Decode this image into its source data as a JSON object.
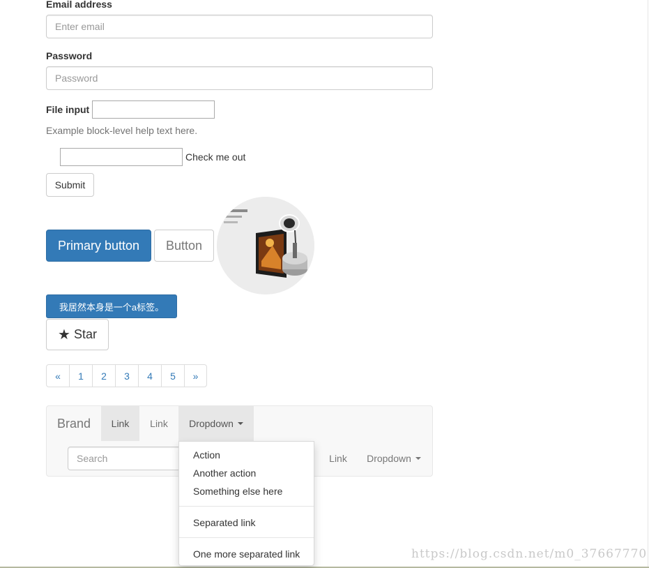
{
  "form": {
    "email_label": "Email address",
    "email_placeholder": "Enter email",
    "password_label": "Password",
    "password_placeholder": "Password",
    "file_label": "File input",
    "help_text": "Example block-level help text here.",
    "checkbox_label": "Check me out",
    "submit_label": "Submit"
  },
  "buttons": {
    "primary_label": "Primary button",
    "default_label": "Button",
    "anchor_label": "我居然本身是一个a标签。",
    "star_glyph": "★",
    "star_label": "Star"
  },
  "pagination": {
    "prev": "«",
    "pages": [
      "1",
      "2",
      "3",
      "4",
      "5"
    ],
    "next": "»"
  },
  "navbar": {
    "brand": "Brand",
    "link_active": "Link",
    "link": "Link",
    "dropdown": "Dropdown",
    "search_placeholder": "Search",
    "right_link": "Link",
    "right_dropdown": "Dropdown"
  },
  "dropdown_menu": {
    "items": [
      "Action",
      "Another action",
      "Something else here"
    ],
    "separated": "Separated link",
    "one_more": "One more separated link"
  },
  "watermark": "https://blog.csdn.net/m0_37667770",
  "colors": {
    "primary": "#337ab7",
    "link": "#337ab7",
    "navbar_bg": "#f8f8f8",
    "active_nav_bg": "#e7e7e7"
  },
  "icons": {
    "star": "star-icon",
    "caret": "caret-down-icon"
  }
}
